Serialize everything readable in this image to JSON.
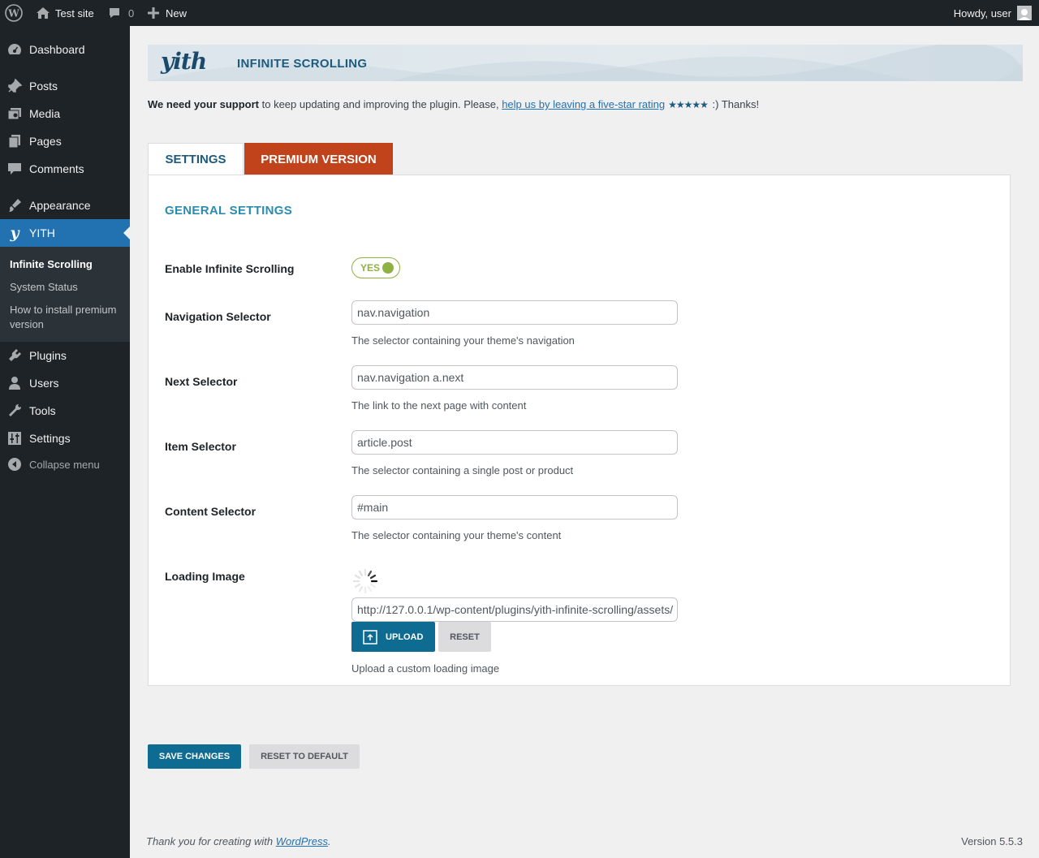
{
  "adminbar": {
    "site_name": "Test site",
    "comments_count": "0",
    "new_label": "New",
    "howdy": "Howdy, user"
  },
  "sidebar": {
    "items": [
      {
        "label": "Dashboard",
        "icon": "dashboard-icon"
      },
      {
        "label": "Posts",
        "icon": "pushpin-icon"
      },
      {
        "label": "Media",
        "icon": "media-icon"
      },
      {
        "label": "Pages",
        "icon": "pages-icon"
      },
      {
        "label": "Comments",
        "icon": "comment-icon"
      },
      {
        "label": "Appearance",
        "icon": "brush-icon"
      },
      {
        "label": "YITH",
        "icon": "yith-icon"
      },
      {
        "label": "Plugins",
        "icon": "plug-icon"
      },
      {
        "label": "Users",
        "icon": "user-icon"
      },
      {
        "label": "Tools",
        "icon": "wrench-icon"
      },
      {
        "label": "Settings",
        "icon": "sliders-icon"
      }
    ],
    "submenu": [
      "Infinite Scrolling",
      "System Status",
      "How to install premium version"
    ],
    "collapse_label": "Collapse menu"
  },
  "banner": {
    "logo": "yith",
    "title": "INFINITE SCROLLING"
  },
  "support": {
    "bold": "We need your support",
    "text": " to keep updating and improving the plugin. Please, ",
    "link": "help us by leaving a five-star rating",
    "stars": "★★★★★",
    "thanks": " :) Thanks!"
  },
  "tabs": {
    "settings": "SETTINGS",
    "premium": "PREMIUM VERSION"
  },
  "panel_title": "GENERAL SETTINGS",
  "fields": {
    "enable": {
      "label": "Enable Infinite Scrolling",
      "toggle": "YES",
      "on": true
    },
    "nav": {
      "label": "Navigation Selector",
      "value": "nav.navigation",
      "desc": "The selector containing your theme's navigation"
    },
    "next": {
      "label": "Next Selector",
      "value": "nav.navigation a.next",
      "desc": "The link to the next page with content"
    },
    "item": {
      "label": "Item Selector",
      "value": "article.post",
      "desc": "The selector containing a single post or product"
    },
    "content": {
      "label": "Content Selector",
      "value": "#main",
      "desc": "The selector containing your theme's content"
    },
    "loading": {
      "label": "Loading Image",
      "value": "http://127.0.0.1/wp-content/plugins/yith-infinite-scrolling/assets/",
      "desc": "Upload a custom loading image",
      "upload": "UPLOAD",
      "reset": "RESET"
    }
  },
  "actions": {
    "save": "SAVE CHANGES",
    "reset_default": "RESET TO DEFAULT"
  },
  "footer": {
    "text": "Thank you for creating with ",
    "link": "WordPress",
    "period": ".",
    "version": "Version 5.5.3"
  },
  "colors": {
    "admin_dark": "#1d2327",
    "wp_blue": "#2271b1",
    "yith_blue": "#0e6c93",
    "premium_orange": "#c0431c",
    "toggle_green": "#8fb043"
  }
}
